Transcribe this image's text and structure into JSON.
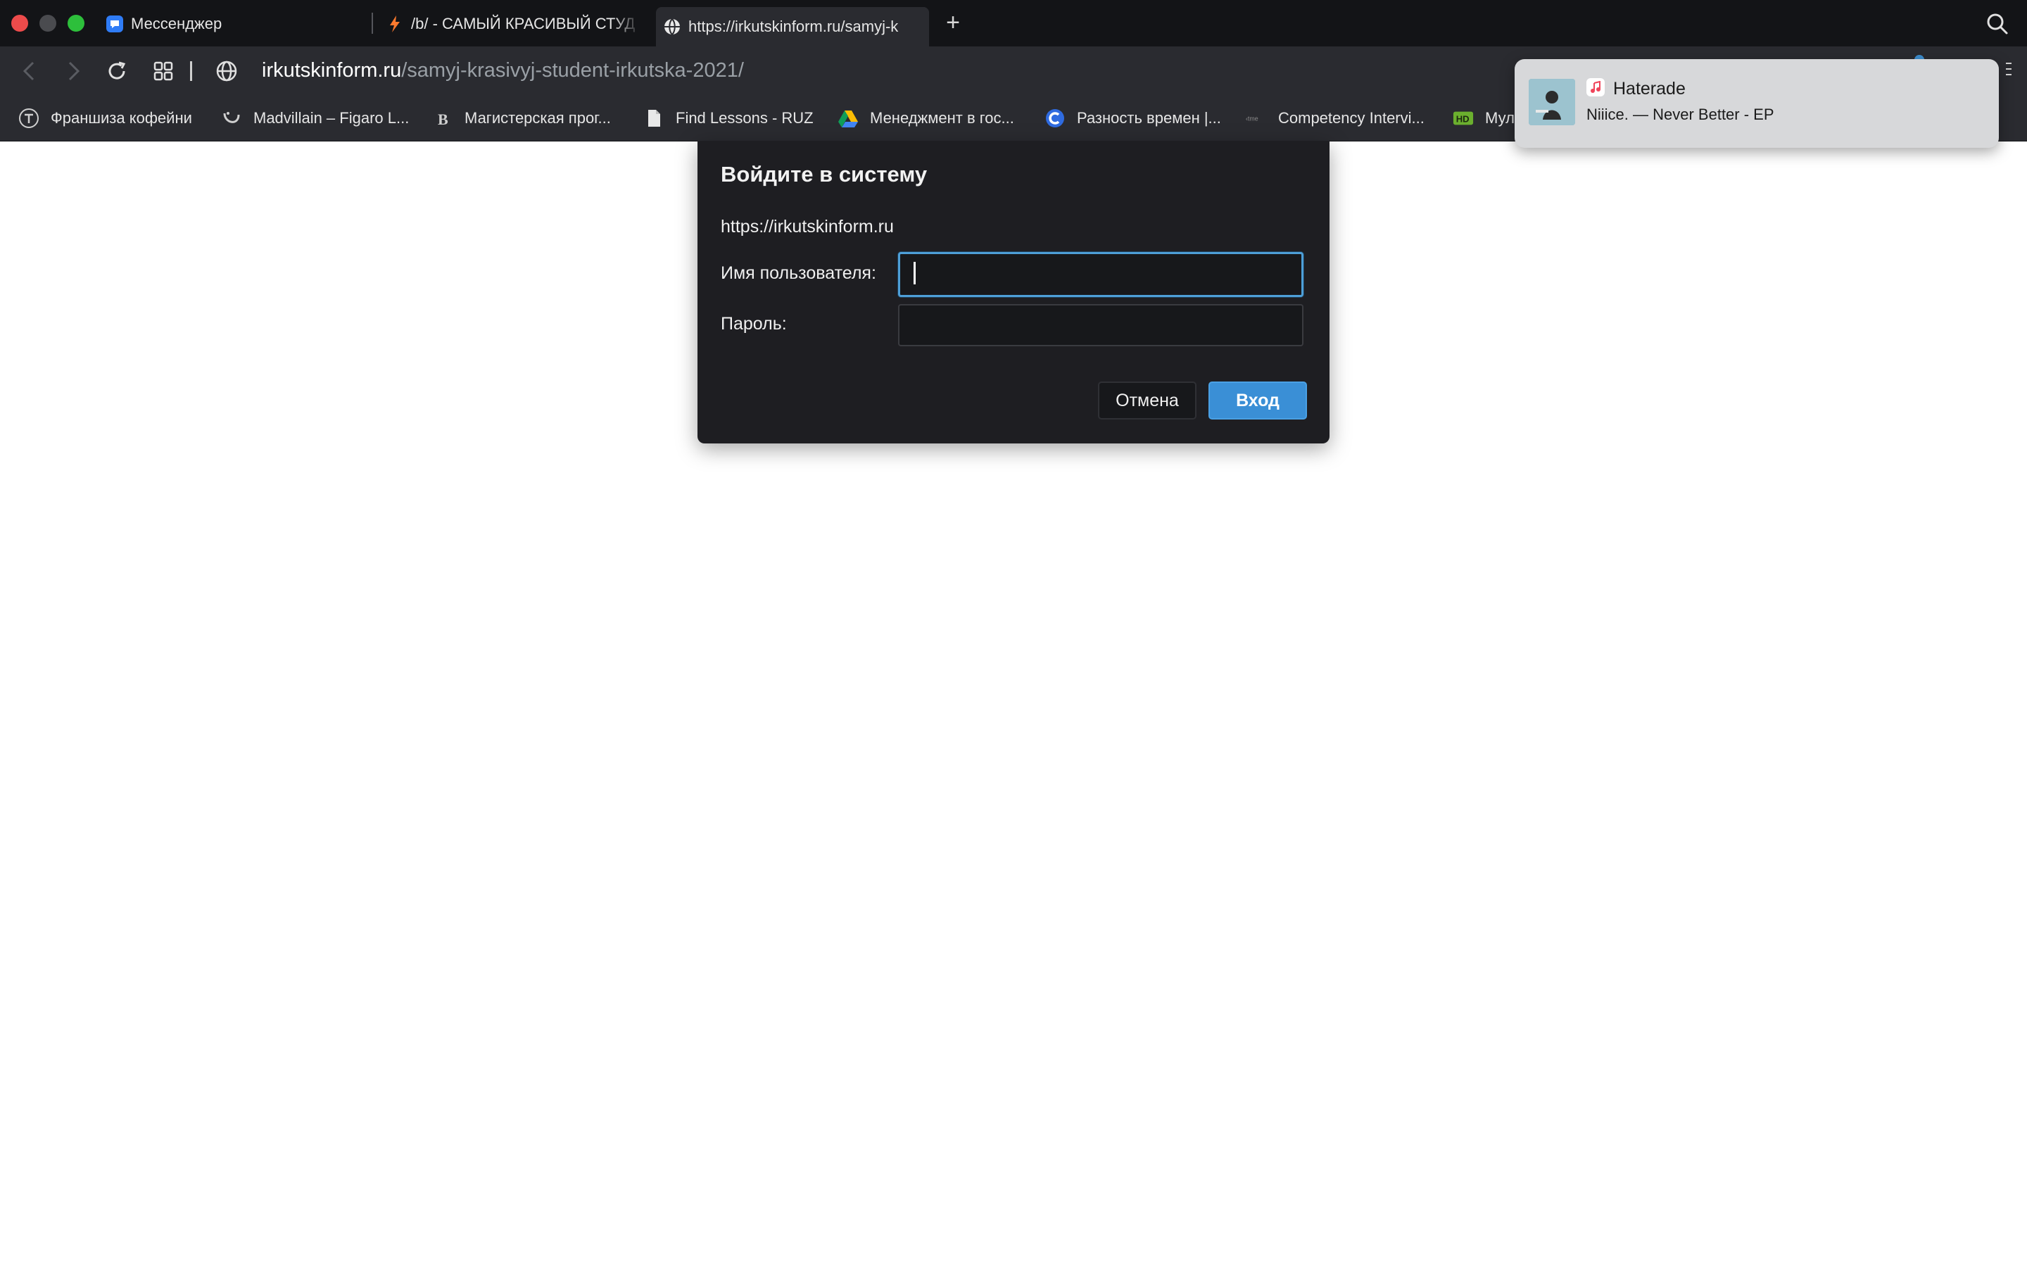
{
  "tabs": [
    {
      "label": "Мессенджер",
      "icon": "messenger-icon"
    },
    {
      "label": "/b/ - САМЫЙ КРАСИВЫЙ СТУД",
      "icon": "lightning-icon"
    },
    {
      "label": "https://irkutskinform.ru/samyj-k",
      "icon": "globe-icon",
      "active": true
    }
  ],
  "toolbar": {
    "url_host": "irkutskinform.ru",
    "url_path": "/samyj-krasivyj-student-irkutska-2021/"
  },
  "bookmarks": [
    {
      "label": "Франшиза кофейни",
      "icon": "t-circle-icon"
    },
    {
      "label": "Madvillain – Figaro L...",
      "icon": "madvillain-icon"
    },
    {
      "label": "Магистерская прог...",
      "icon": "hse-icon"
    },
    {
      "label": "Find Lessons - RUZ",
      "icon": "document-icon"
    },
    {
      "label": "Менеджмент в гос...",
      "icon": "drive-icon"
    },
    {
      "label": "Разность времен |...",
      "icon": "c-logo-icon"
    },
    {
      "label": "Competency Intervi...",
      "icon": "tme-icon"
    },
    {
      "label": "Мул",
      "icon": "hd-icon"
    }
  ],
  "dialog": {
    "title": "Войдите в систему",
    "site": "https://irkutskinform.ru",
    "username_label": "Имя пользователя:",
    "username_value": "",
    "password_label": "Пароль:",
    "password_value": "",
    "cancel_label": "Отмена",
    "submit_label": "Вход"
  },
  "notification": {
    "title": "Haterade",
    "subtitle": "Niiice. — Never Better - EP",
    "app_icon": "music-note-icon"
  },
  "colors": {
    "accent": "#3a8fd6",
    "focus_ring": "#4e9fd8",
    "dialog_bg": "#1e1e22",
    "toolbar_bg": "#2a2b30"
  }
}
